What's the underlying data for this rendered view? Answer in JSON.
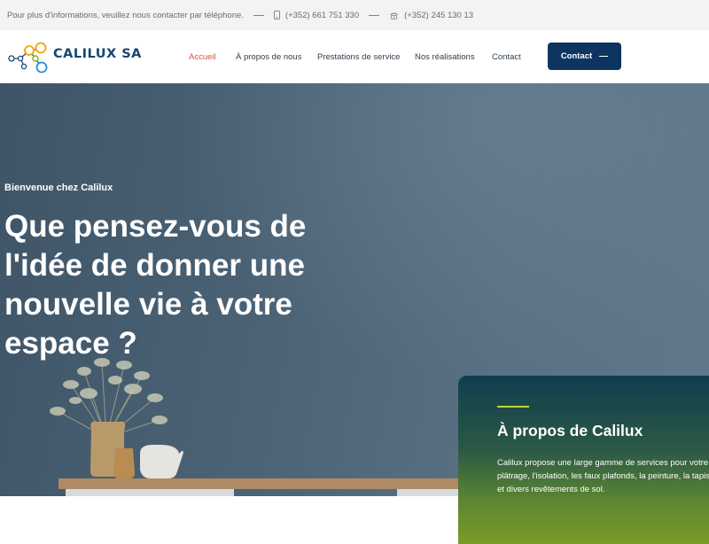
{
  "topbar": {
    "info": "Pour plus d'informations, veuillez nous contacter par téléphone.",
    "phone_mobile": "(+352) 661 751 330",
    "phone_landline": "(+352) 245 130 13"
  },
  "header": {
    "logo_text": "CALILUX SA",
    "nav": [
      {
        "label": "Accueil",
        "active": true
      },
      {
        "label": "À propos de nous"
      },
      {
        "label": "Prestations de service"
      },
      {
        "label": "Nos réalisations"
      },
      {
        "label": "Contact"
      }
    ],
    "cta_label": "Contact"
  },
  "hero": {
    "subtitle": "Bienvenue chez Calilux",
    "title_lines": [
      "Que pensez-vous de",
      "l'idée de donner une",
      "nouvelle vie à votre",
      "espace ?"
    ]
  },
  "about": {
    "title": "À propos de Calilux",
    "text_lines": [
      "Calilux propose une large gamme de services pour votre",
      "plâtrage, l'isolation, les faux plafonds, la peinture, la tapis",
      "et divers revêtements de sol."
    ]
  },
  "colors": {
    "accent": "#e2513f",
    "brand_navy": "#0d3560",
    "logo_text": "#17466f",
    "accent_lime": "#c6d432"
  }
}
